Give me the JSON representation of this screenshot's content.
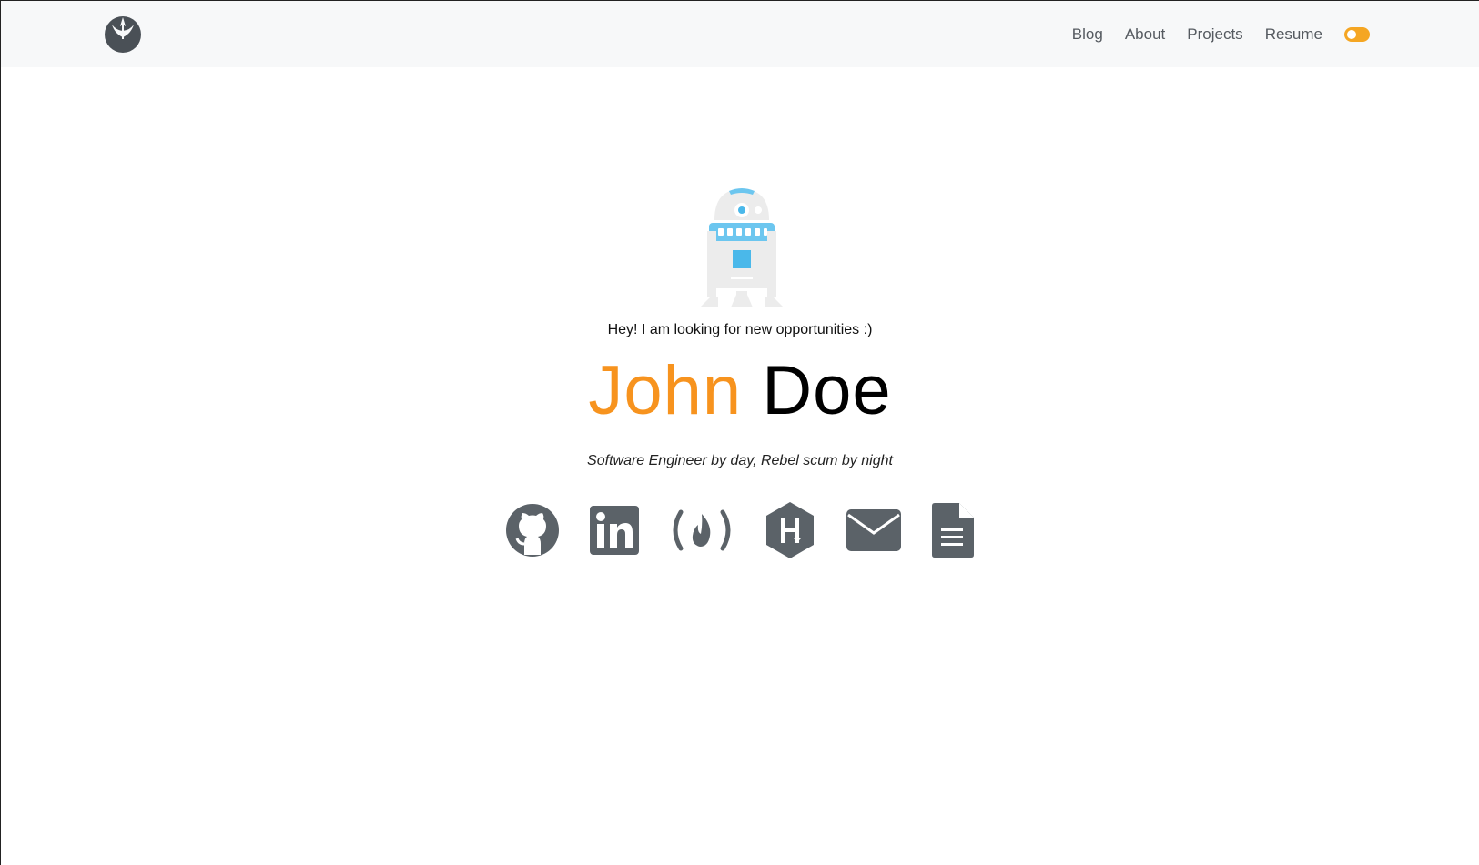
{
  "nav": {
    "links": [
      {
        "label": "Blog"
      },
      {
        "label": "About"
      },
      {
        "label": "Projects"
      },
      {
        "label": "Resume"
      }
    ],
    "brand_icon": "rebel-alliance-icon",
    "theme_toggle_icon": "theme-toggle"
  },
  "hero": {
    "avatar_icon": "r2d2-icon",
    "tagline": "Hey! I am looking for new opportunities :)",
    "first_name": "John",
    "last_name": "Doe",
    "subtitle": "Software Engineer by day, Rebel scum by night"
  },
  "socials": [
    {
      "icon": "github-icon"
    },
    {
      "icon": "linkedin-icon"
    },
    {
      "icon": "freecodecamp-icon"
    },
    {
      "icon": "hackerrank-icon"
    },
    {
      "icon": "email-icon"
    },
    {
      "icon": "resume-document-icon"
    }
  ],
  "colors": {
    "accent": "#f7931e",
    "icon": "#5b6268",
    "navbar_bg": "#f7f8f9",
    "toggle": "#f5a623"
  }
}
